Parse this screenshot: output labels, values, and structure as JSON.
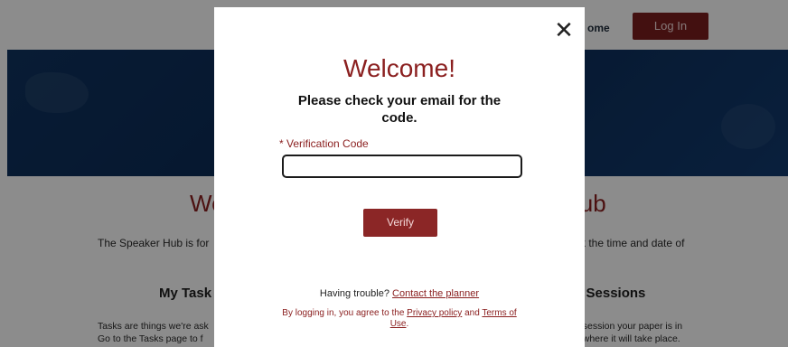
{
  "header": {
    "nav_home": "ome",
    "login_label": "Log In"
  },
  "page": {
    "headline_left": "We",
    "headline_right": "lub",
    "intro_left": "The Speaker Hub is for",
    "intro_right": "ck the time and date of",
    "section_left": "My Task",
    "section_right": "y Sessions",
    "tasks_line1": "Tasks are things we're ask",
    "tasks_line2": "Go to the Tasks page to f",
    "sessions_line1": "n session your paper is in",
    "sessions_line2": "d where it will take place."
  },
  "modal": {
    "close_glyph": "✕",
    "title": "Welcome!",
    "subtitle": "Please check your email for the code.",
    "field_label": "* Verification Code",
    "field_value": "",
    "verify_label": "Verify",
    "trouble_text": "Having trouble?",
    "trouble_link": "Contact the planner",
    "terms_prefix": "By logging in, you agree to the",
    "privacy_link": "Privacy policy",
    "terms_and": "and",
    "terms_link": "Terms of Use",
    "terms_suffix": "."
  },
  "colors": {
    "accent": "#8b2020",
    "login_bg": "#7a1e1e",
    "hero_bg": "#0b2b55"
  }
}
